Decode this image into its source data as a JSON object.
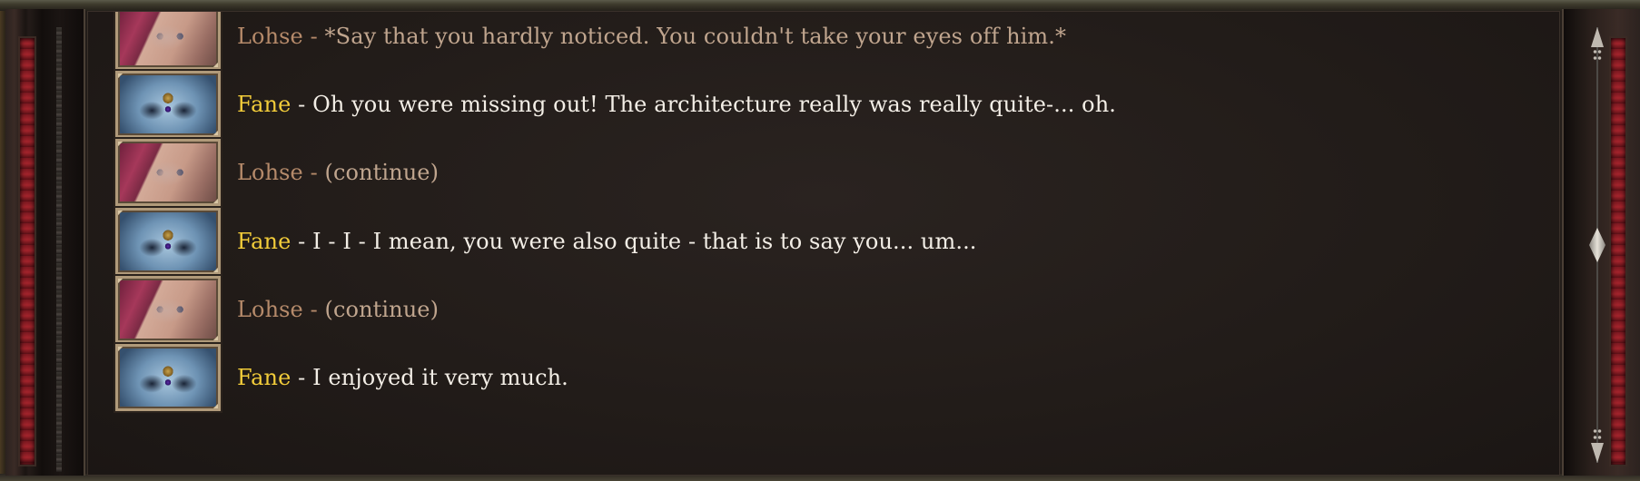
{
  "dialogue_log": {
    "separator": " - ",
    "entries": [
      {
        "speaker": "Lohse",
        "character": "lohse",
        "text": "*Say that you hardly noticed. You couldn't take your eyes off him.*"
      },
      {
        "speaker": "Fane",
        "character": "fane",
        "text": "Oh you were missing out! The architecture really was really quite-... oh."
      },
      {
        "speaker": "Lohse",
        "character": "lohse",
        "text": "(continue)"
      },
      {
        "speaker": "Fane",
        "character": "fane",
        "text": "I - I - I mean, you were also quite - that is to say you... um..."
      },
      {
        "speaker": "Lohse",
        "character": "lohse",
        "text": "(continue)"
      },
      {
        "speaker": "Fane",
        "character": "fane",
        "text": "I enjoyed it very much."
      }
    ]
  },
  "colors": {
    "lohse_name": "#b58a6a",
    "fane_name": "#f2cc3a",
    "lohse_text": "#c0a58e",
    "fane_text": "#f3eee6",
    "frame_red": "#a3242c"
  },
  "scrollbar": {
    "up_icon": "arrow-up-icon",
    "down_icon": "arrow-down-icon",
    "thumb_icon": "diamond-thumb-icon",
    "scroll_position": 0.5
  }
}
